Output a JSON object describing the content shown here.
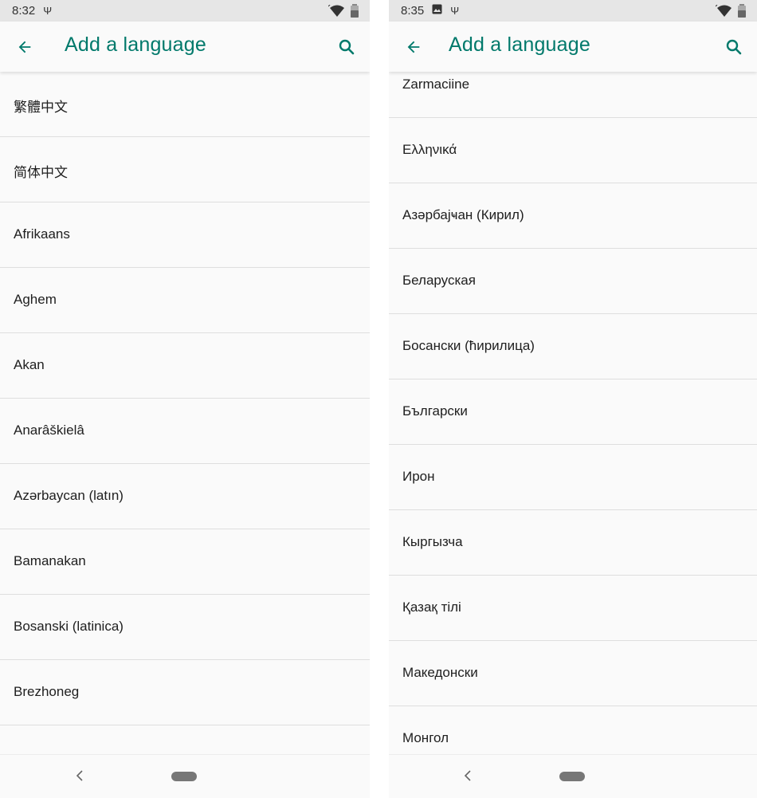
{
  "left_screen": {
    "status": {
      "time": "8:32",
      "usb_glyph": "Ψ"
    },
    "app_bar": {
      "title": "Add a language"
    },
    "languages": [
      "繁體中文",
      "简体中文",
      "Afrikaans",
      "Aghem",
      "Akan",
      "Anarâškielâ",
      "Azərbaycan (latın)",
      "Bamanakan",
      "Bosanski (latinica)",
      "Brezhoneg"
    ]
  },
  "right_screen": {
    "status": {
      "time": "8:35",
      "usb_glyph": "Ψ"
    },
    "app_bar": {
      "title": "Add a language"
    },
    "languages": [
      "Zarmaciine",
      "Ελληνικά",
      "Азәрбајҹан (Кирил)",
      "Беларуская",
      "Босански (ћирилица)",
      "Български",
      "Ирон",
      "Кыргызча",
      "Қазақ тілі",
      "Македонски",
      "Монгол"
    ]
  },
  "icons": {
    "back": "arrow-left-icon",
    "search": "search-icon",
    "wifi": "wifi-icon",
    "battery": "battery-icon",
    "usb": "usb-icon",
    "image": "image-icon",
    "nav_back": "nav-back-icon",
    "nav_home": "nav-home-pill"
  },
  "colors": {
    "accent": "#00796b",
    "background": "#fafafa",
    "status_bar": "#e6e6e6",
    "divider": "#dedede",
    "text": "#202020"
  }
}
